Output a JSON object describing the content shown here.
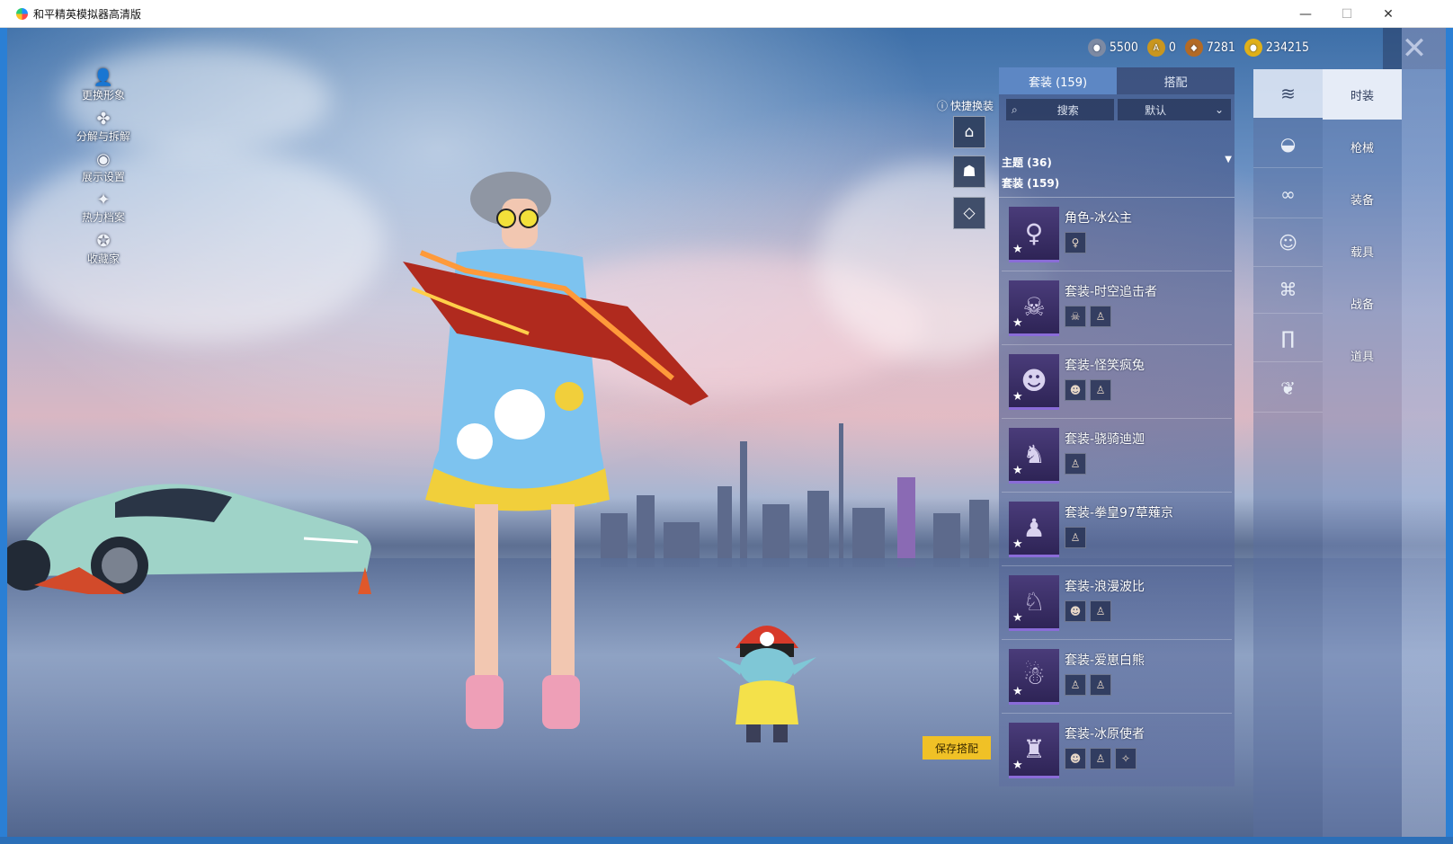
{
  "window": {
    "title": "和平精英模拟器高清版",
    "minimize": "—",
    "maximize": "☐",
    "close": "✕"
  },
  "left_menu": [
    {
      "label": "更换形象",
      "icon": "person-icon",
      "glyph": "👤"
    },
    {
      "label": "分解与拆解",
      "icon": "puzzle-icon",
      "glyph": "✤"
    },
    {
      "label": "展示设置",
      "icon": "eye-icon",
      "glyph": "◉"
    },
    {
      "label": "热力档案",
      "icon": "flame-icon",
      "glyph": "✦"
    },
    {
      "label": "收藏家",
      "icon": "badge-icon",
      "glyph": "✪"
    }
  ],
  "currency": [
    {
      "value": "5500",
      "icon": "silver-coin-icon",
      "color": "#7d8aa3"
    },
    {
      "value": "0",
      "icon": "a-coin-icon",
      "color": "#c9961f"
    },
    {
      "value": "7281",
      "icon": "bronze-coin-icon",
      "color": "#b36a25"
    },
    {
      "value": "234215",
      "icon": "gold-coin-icon",
      "color": "#e0b018"
    }
  ],
  "quick_change": {
    "label": "快捷换装",
    "buttons": [
      {
        "icon": "hanger-icon",
        "glyph": "⌂"
      },
      {
        "icon": "locked-helmet-icon",
        "glyph": "☗"
      },
      {
        "icon": "locked-diamond-icon",
        "glyph": "◇"
      }
    ]
  },
  "outfit_panel": {
    "tabs": [
      "套装 (159)",
      "搭配"
    ],
    "search_label": "搜索",
    "sort_value": "默认",
    "theme_label": "主题 (36)",
    "suit_label": "套装 (159)",
    "items": [
      {
        "name": "角色-冰公主",
        "glyph": "♀",
        "parts": [
          "♀"
        ]
      },
      {
        "name": "套装-时空追击者",
        "glyph": "☠",
        "parts": [
          "☠",
          "♙"
        ]
      },
      {
        "name": "套装-怪笑疯兔",
        "glyph": "☻",
        "parts": [
          "☻",
          "♙"
        ]
      },
      {
        "name": "套装-骁骑迪迦",
        "glyph": "♞",
        "parts": [
          "♙"
        ]
      },
      {
        "name": "套装-拳皇97草薙京",
        "glyph": "♟",
        "parts": [
          "♙"
        ]
      },
      {
        "name": "套装-浪漫波比",
        "glyph": "♘",
        "parts": [
          "☻",
          "♙"
        ]
      },
      {
        "name": "套装-爱崽白熊",
        "glyph": "☃",
        "parts": [
          "♙",
          "♙"
        ]
      },
      {
        "name": "套装-冰原使者",
        "glyph": "♜",
        "parts": [
          "☻",
          "♙",
          "✧"
        ]
      }
    ]
  },
  "save_button": "保存搭配",
  "slots": [
    {
      "icon": "outfit-icon",
      "glyph": "≋"
    },
    {
      "icon": "hat-icon",
      "glyph": "◒"
    },
    {
      "icon": "glasses-icon",
      "glyph": "∞"
    },
    {
      "icon": "mask-icon",
      "glyph": "☺"
    },
    {
      "icon": "top-icon",
      "glyph": "⌘"
    },
    {
      "icon": "pants-icon",
      "glyph": "∏"
    },
    {
      "icon": "shoes-icon",
      "glyph": "❦"
    }
  ],
  "categories": [
    "时装",
    "枪械",
    "装备",
    "载具",
    "战备",
    "道具"
  ]
}
